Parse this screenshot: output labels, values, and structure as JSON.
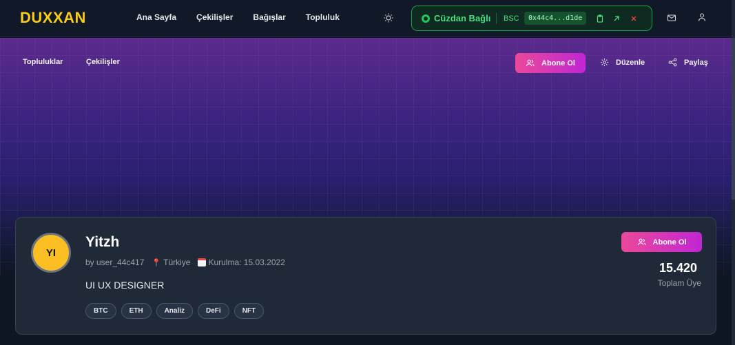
{
  "header": {
    "logo": "DUXXAN",
    "nav": [
      "Ana Sayfa",
      "Çekilişler",
      "Bağışlar",
      "Topluluk"
    ],
    "wallet": {
      "status": "Cüzdan Bağlı",
      "chain": "BSC",
      "address": "0x44c4...d1de"
    }
  },
  "banner": {
    "tabs": [
      "Topluluklar",
      "Çekilişler"
    ],
    "subscribe_label": "Abone Ol",
    "edit_label": "Düzenle",
    "share_label": "Paylaş"
  },
  "profile": {
    "initials": "YI",
    "name": "Yitzh",
    "author": "by user_44c417",
    "location": "Türkiye",
    "founded": "Kurulma: 15.03.2022",
    "bio": "UI UX DESIGNER",
    "tags": [
      "BTC",
      "ETH",
      "Analiz",
      "DeFi",
      "NFT"
    ],
    "subscribe_label": "Abone Ol",
    "member_count": "15.420",
    "member_label": "Toplam Üye"
  },
  "colors": {
    "accent_yellow": "#facc15",
    "wallet_green": "#22c55e",
    "subscribe_pink": "#ec4899",
    "subscribe_purple": "#c026d3"
  }
}
